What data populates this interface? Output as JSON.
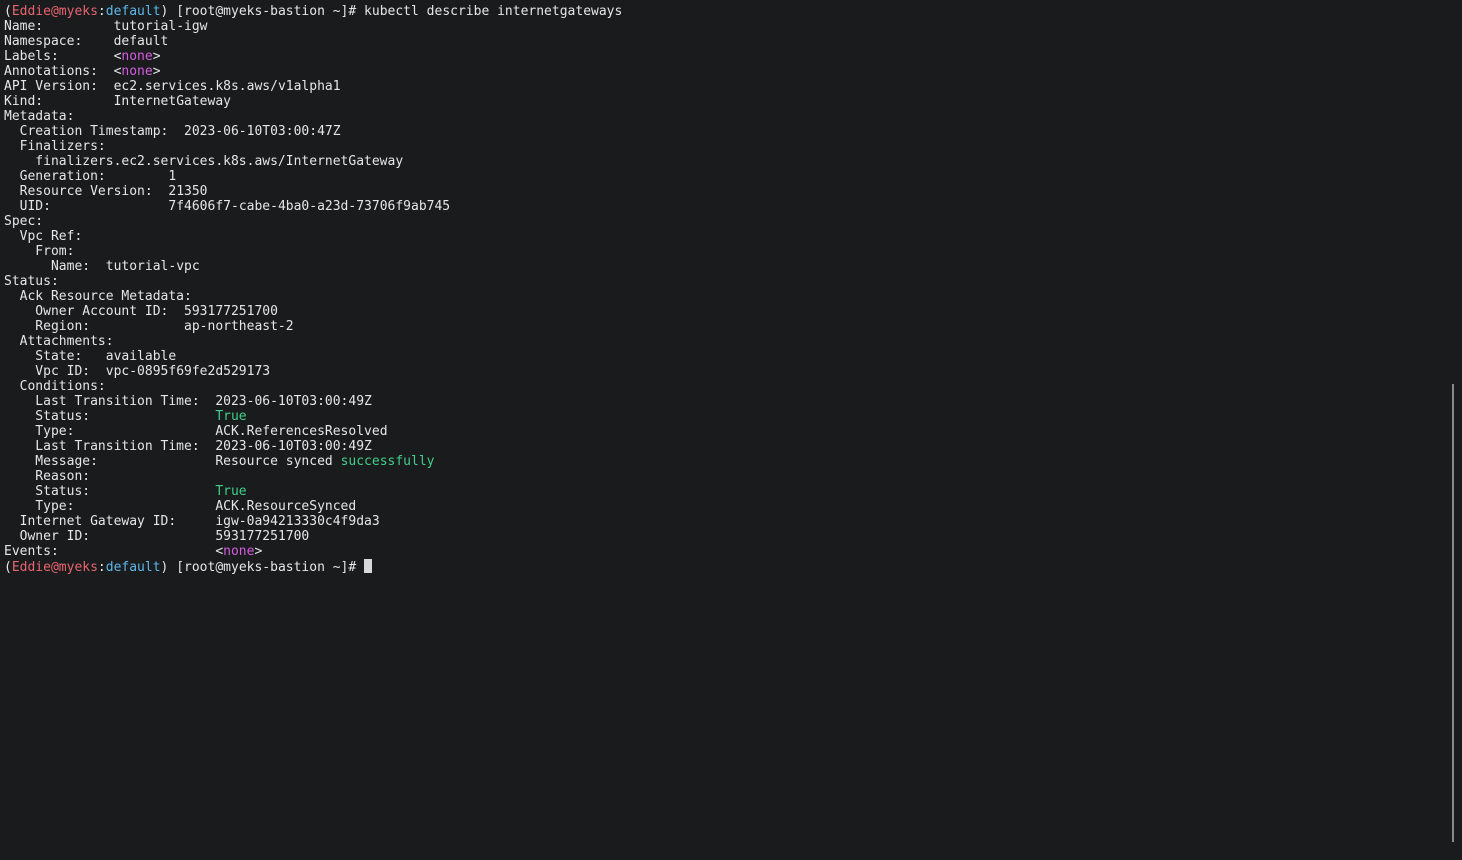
{
  "prompt": {
    "open_paren": "(",
    "user": "Eddie@myeks",
    "sep": ":",
    "context": "default",
    "rest": ") [root@myeks-bastion ~]# "
  },
  "command": "kubectl describe internetgateways",
  "lines": {
    "name": {
      "key": "Name:         ",
      "value": "tutorial-igw"
    },
    "namespace": {
      "key": "Namespace:    ",
      "value": "default"
    },
    "labels": {
      "key": "Labels:       ",
      "pre": "<",
      "value": "none",
      "post": ">"
    },
    "annotations": {
      "key": "Annotations:  ",
      "pre": "<",
      "value": "none",
      "post": ">"
    },
    "api_version": {
      "key": "API Version:  ",
      "value": "ec2.services.k8s.aws/v1alpha1"
    },
    "kind": {
      "key": "Kind:         ",
      "value": "InternetGateway"
    },
    "metadata": {
      "key": "Metadata:"
    },
    "creation_timestamp": {
      "key": "  Creation Timestamp:  ",
      "value": "2023-06-10T03:00:47Z"
    },
    "finalizers": {
      "key": "  Finalizers:"
    },
    "finalizer_value": {
      "value": "    finalizers.ec2.services.k8s.aws/InternetGateway"
    },
    "generation": {
      "key": "  Generation:        ",
      "value": "1"
    },
    "resource_version": {
      "key": "  Resource Version:  ",
      "value": "21350"
    },
    "uid": {
      "key": "  UID:               ",
      "value": "7f4606f7-cabe-4ba0-a23d-73706f9ab745"
    },
    "spec": {
      "key": "Spec:"
    },
    "vpc_ref": {
      "key": "  Vpc Ref:"
    },
    "from": {
      "key": "    From:"
    },
    "from_name": {
      "key": "      Name:  ",
      "value": "tutorial-vpc"
    },
    "status": {
      "key": "Status:"
    },
    "ack_metadata": {
      "key": "  Ack Resource Metadata:"
    },
    "owner_account_id": {
      "key": "    Owner Account ID:  ",
      "value": "593177251700"
    },
    "region": {
      "key": "    Region:            ",
      "value": "ap-northeast-2"
    },
    "attachments": {
      "key": "  Attachments:"
    },
    "attach_state": {
      "key": "    State:   ",
      "value": "available"
    },
    "attach_vpc_id": {
      "key": "    Vpc ID:  ",
      "value": "vpc-0895f69fe2d529173"
    },
    "conditions": {
      "key": "  Conditions:"
    },
    "c1_time": {
      "key": "    Last Transition Time:  ",
      "value": "2023-06-10T03:00:49Z"
    },
    "c1_status": {
      "key": "    Status:                ",
      "value": "True"
    },
    "c1_type": {
      "key": "    Type:                  ",
      "value": "ACK.ReferencesResolved"
    },
    "c2_time": {
      "key": "    Last Transition Time:  ",
      "value": "2023-06-10T03:00:49Z"
    },
    "c2_message": {
      "key": "    Message:               ",
      "value": "Resource synced ",
      "highlight": "successfully"
    },
    "c2_reason": {
      "key": "    Reason:"
    },
    "c2_status": {
      "key": "    Status:                ",
      "value": "True"
    },
    "c2_type": {
      "key": "    Type:                  ",
      "value": "ACK.ResourceSynced"
    },
    "igw_id": {
      "key": "  Internet Gateway ID:     ",
      "value": "igw-0a94213330c4f9da3"
    },
    "owner_id": {
      "key": "  Owner ID:                ",
      "value": "593177251700"
    },
    "events": {
      "key": "Events:                    ",
      "pre": "<",
      "value": "none",
      "post": ">"
    }
  },
  "colors": {
    "background": "#1a1b1d",
    "text": "#e6e6e6",
    "user": "#e8646f",
    "context": "#5db9e8",
    "none_value": "#d45ce0",
    "success": "#3fd08a"
  }
}
